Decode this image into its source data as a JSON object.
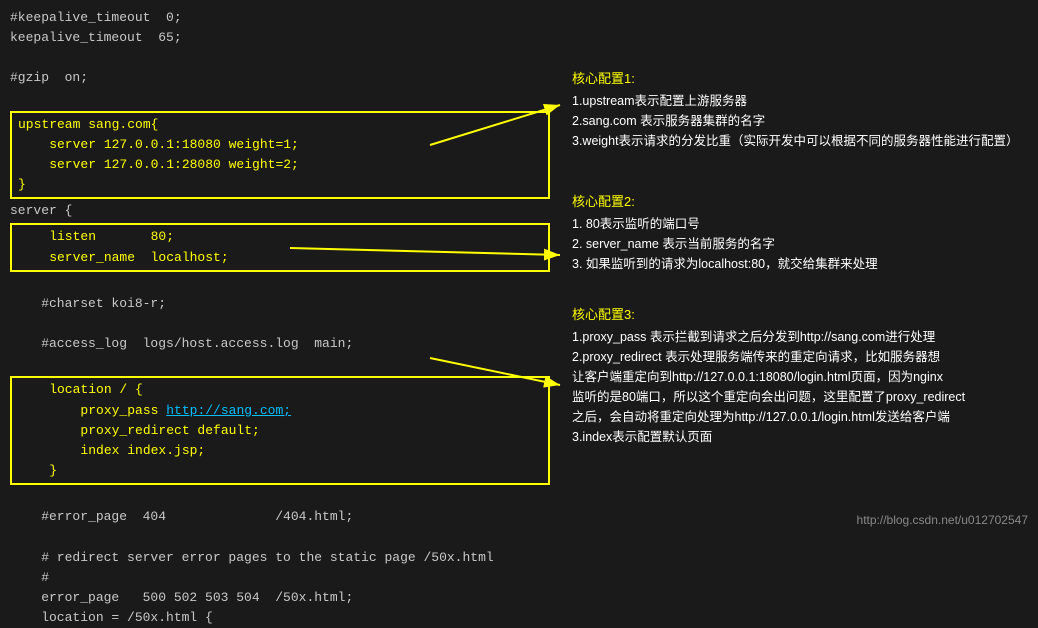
{
  "code": {
    "lines": [
      {
        "text": "#keepalive_timeout  0;",
        "type": "comment"
      },
      {
        "text": "keepalive_timeout  65;",
        "type": "normal"
      },
      {
        "text": "",
        "type": "normal"
      },
      {
        "text": "#gzip  on;",
        "type": "comment"
      },
      {
        "text": "",
        "type": "normal"
      }
    ],
    "upstream_block": [
      "upstream sang.com{",
      "    server 127.0.0.1:18080 weight=1;",
      "    server 127.0.0.1:28080 weight=2;",
      "}"
    ],
    "server_start": "server {",
    "listen_block": [
      "    listen       80;",
      "    server_name  localhost;"
    ],
    "middle_lines": [
      "",
      "    #charset koi8-r;",
      "",
      "    #access_log  logs/host.access.log  main;",
      ""
    ],
    "location_block": [
      "    location / {",
      "        proxy_pass http://sang.com;",
      "        proxy_redirect default;",
      "        index index.jsp;",
      "    }"
    ],
    "bottom_lines": [
      "",
      "    #error_page  404              /404.html;",
      "",
      "    # redirect server error pages to the static page /50x.html",
      "    #",
      "    error_page   500 502 503 504  /50x.html;",
      "    location = /50x.html {"
    ]
  },
  "annotations": {
    "section1": {
      "title": "核心配置1:",
      "items": [
        "1.upstream表示配置上游服务器",
        "2.sang.com 表示服务器集群的名字",
        "3.weight表示请求的分发比重（实际开发中可以根据不同的服务器性能进行配置）"
      ]
    },
    "section2": {
      "title": "核心配置2:",
      "items": [
        "1. 80表示监听的端口号",
        "2. server_name 表示当前服务的名字",
        "3. 如果监听到的请求为localhost:80，就交给集群来处理"
      ]
    },
    "section3": {
      "title": "核心配置3:",
      "items": [
        "1.proxy_pass 表示拦截到请求之后分发到http://sang.com进行处理",
        "2.proxy_redirect 表示处理服务端传来的重定向请求，比如服务器想",
        "让客户端重定向到http://127.0.0.1:18080/login.html页面，因为nginx",
        "监听的是80端口，所以这个重定向会出问题，这里配置了proxy_redirect",
        "之后，会自动将重定向处理为http://127.0.0.1/login.html发送给客户端",
        "3.index表示配置默认页面"
      ]
    }
  },
  "watermark": "http://blog.csdn.net/u012702547"
}
